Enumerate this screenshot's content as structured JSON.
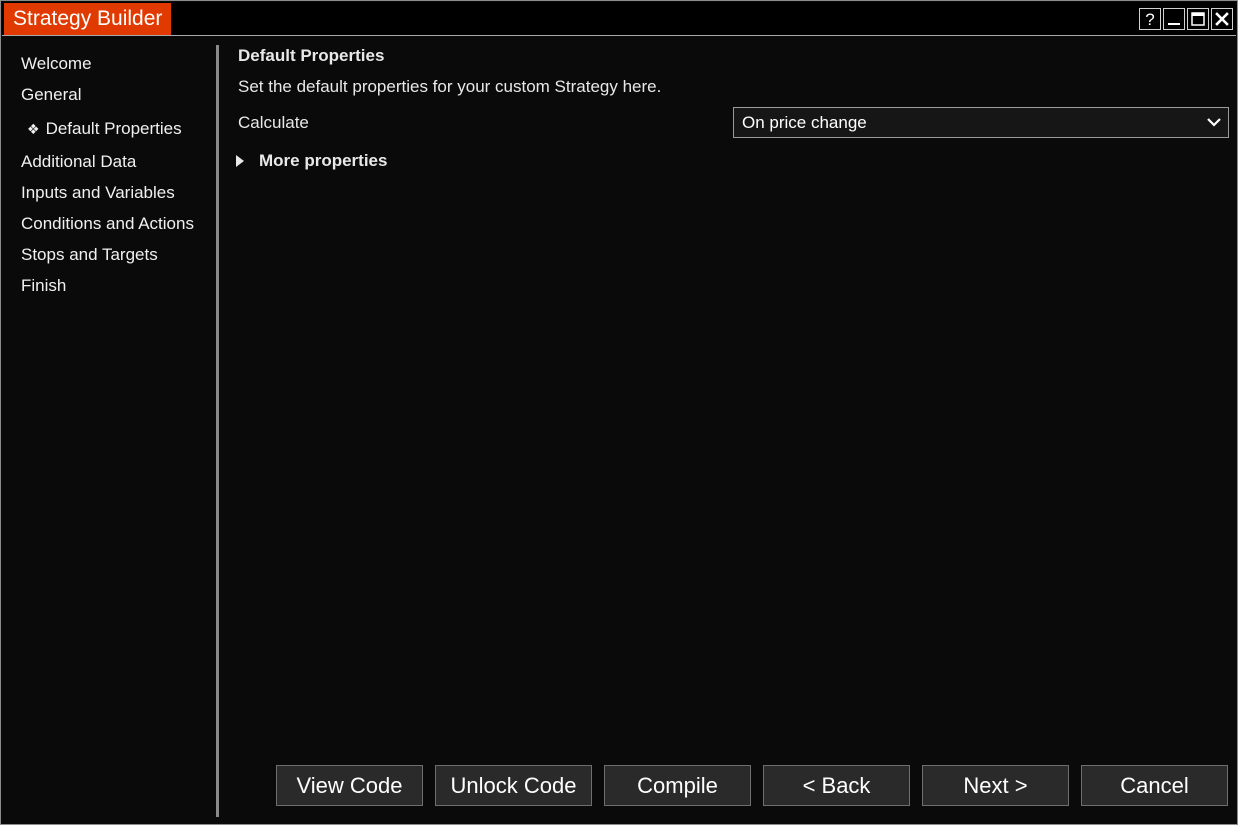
{
  "window": {
    "title": "Strategy Builder",
    "controls": {
      "help": "?"
    }
  },
  "sidebar": {
    "items": [
      {
        "label": "Welcome"
      },
      {
        "label": "General"
      },
      {
        "label": "Default Properties",
        "bullet": "❖",
        "selected": true
      },
      {
        "label": "Additional Data"
      },
      {
        "label": "Inputs and Variables"
      },
      {
        "label": "Conditions and Actions"
      },
      {
        "label": "Stops and Targets"
      },
      {
        "label": "Finish"
      }
    ]
  },
  "main": {
    "title": "Default Properties",
    "description": "Set the default properties for your custom Strategy here.",
    "calculate": {
      "label": "Calculate",
      "value": "On price change"
    },
    "more_properties": "More properties"
  },
  "buttons": {
    "view_code": "View Code",
    "unlock_code": "Unlock Code",
    "compile": "Compile",
    "back": "< Back",
    "next": "Next >",
    "cancel": "Cancel"
  },
  "colors": {
    "title_accent": "#e03a00",
    "background": "#0a0a0a",
    "button_bg": "#2a2a2a"
  },
  "icons": {
    "help": "help-icon",
    "minimize": "minimize-icon",
    "maximize": "maximize-icon",
    "close": "close-icon",
    "dropdown": "chevron-down-icon",
    "expand": "expand-triangle-icon",
    "selected_bullet": "diamond-bullet-icon"
  }
}
